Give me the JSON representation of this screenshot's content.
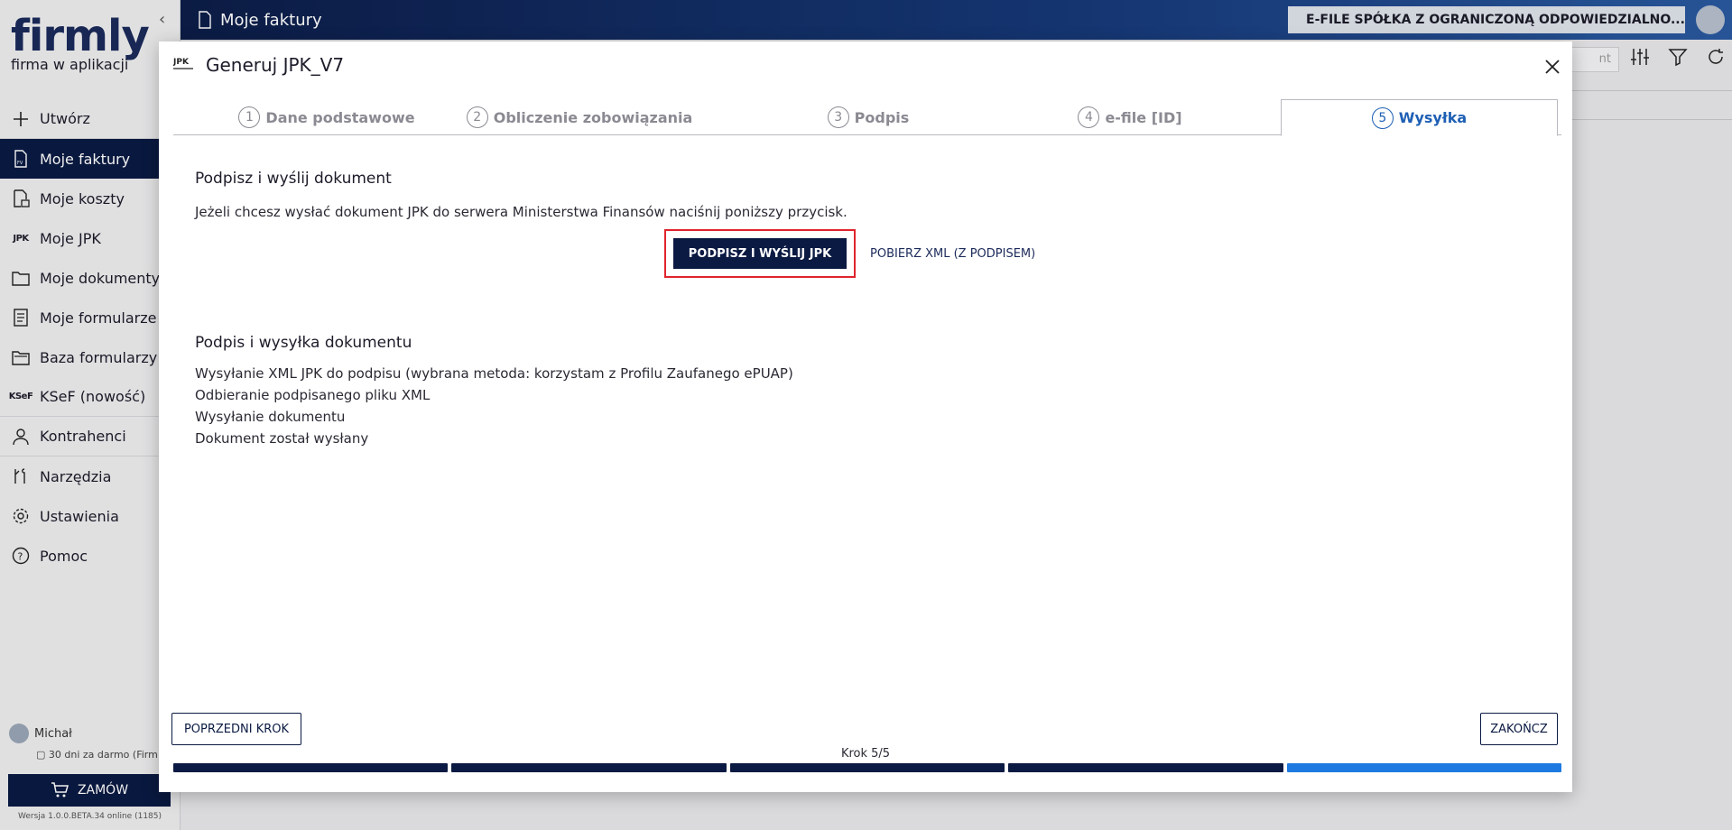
{
  "sidebar": {
    "logo": "firmly",
    "tagline": "firma w aplikacji",
    "items": [
      {
        "label": "Utwórz",
        "icon": "plus-icon"
      },
      {
        "label": "Moje faktury",
        "icon": "invoice-icon"
      },
      {
        "label": "Moje koszty",
        "icon": "costs-icon"
      },
      {
        "label": "Moje JPK",
        "icon": "jpk-icon",
        "icon_text": "JPK"
      },
      {
        "label": "Moje dokumenty",
        "icon": "folder-icon"
      },
      {
        "label": "Moje formularze",
        "icon": "form-icon"
      },
      {
        "label": "Baza formularzy",
        "icon": "folders-icon"
      },
      {
        "label": "KSeF (nowość)",
        "icon": "ksef-icon",
        "icon_text": "KSeF"
      },
      {
        "label": "Kontrahenci",
        "icon": "person-icon"
      },
      {
        "label": "Narzędzia",
        "icon": "tools-icon"
      },
      {
        "label": "Ustawienia",
        "icon": "gear-icon"
      },
      {
        "label": "Pomoc",
        "icon": "help-icon"
      }
    ],
    "active_index": 1,
    "user_name": "Michał",
    "trial_text": "30 dni za darmo (Firm",
    "order_label": "ZAMÓW",
    "version": "Wersja 1.0.0.BETA.34 online (1185)"
  },
  "topbar": {
    "title": "Moje faktury",
    "company": "E-FILE SPÓŁKA Z OGRANICZONĄ ODPOWIEDZIALNO..."
  },
  "background": {
    "search_placeholder": "nt"
  },
  "modal": {
    "icon_text": "JPK",
    "title": "Generuj JPK_V7",
    "steps": [
      {
        "num": "1",
        "label": "Dane podstawowe"
      },
      {
        "num": "2",
        "label": "Obliczenie zobowiązania"
      },
      {
        "num": "3",
        "label": "Podpis"
      },
      {
        "num": "4",
        "label": "e-file [ID]"
      },
      {
        "num": "5",
        "label": "Wysyłka"
      }
    ],
    "active_step": 5,
    "section1_title": "Podpisz i wyślij dokument",
    "section1_text": "Jeżeli chcesz wysłać dokument JPK do serwera Ministerstwa Finansów naciśnij poniższy przycisk.",
    "sign_send_label": "PODPISZ I WYŚLIJ JPK",
    "download_xml_label": "POBIERZ XML (Z PODPISEM)",
    "section2_title": "Podpis i wysyłka dokumentu",
    "status_lines": [
      "Wysyłanie XML JPK do podpisu (wybrana metoda: korzystam z Profilu Zaufanego ePUAP)",
      "Odbieranie podpisanego pliku XML",
      "Wysyłanie dokumentu",
      "Dokument został wysłany"
    ],
    "prev_label": "POPRZEDNI KROK",
    "finish_label": "ZAKOŃCZ",
    "progress_label": "Krok 5/5",
    "progress_current": 5,
    "progress_total": 5
  },
  "colors": {
    "navy": "#0a1a42",
    "accent_blue": "#1e5fb4",
    "progress_current": "#1e7ae0",
    "highlight_red": "#e0242c"
  }
}
